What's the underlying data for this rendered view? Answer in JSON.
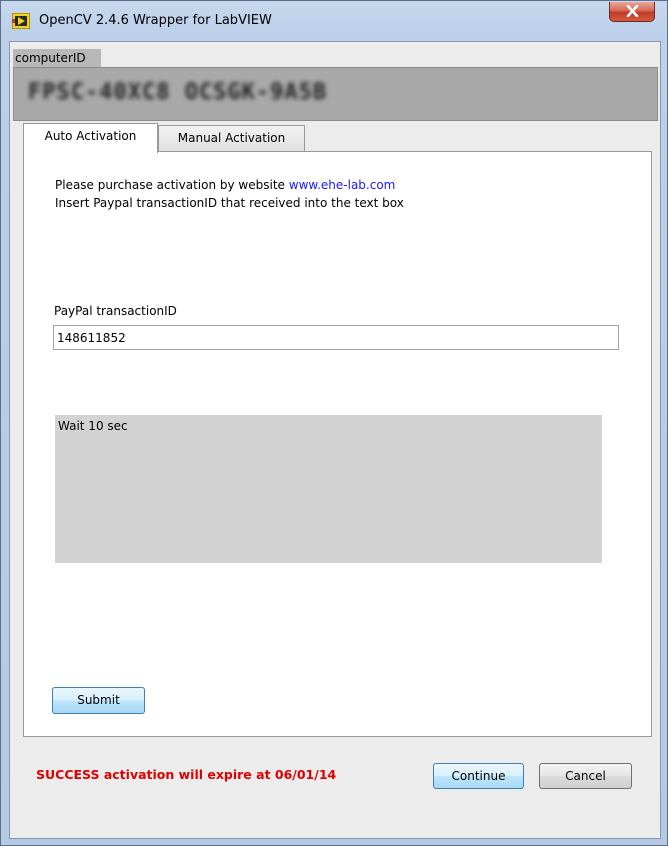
{
  "window": {
    "title": "OpenCV 2.4.6 Wrapper for LabVIEW",
    "close_icon": "close-icon"
  },
  "computer_id": {
    "label": "computerID",
    "value": "FPSC-40XC8 OCSGK-9A5B"
  },
  "tabs": [
    {
      "label": "Auto Activation",
      "active": true
    },
    {
      "label": "Manual Activation",
      "active": false
    }
  ],
  "auto_activation": {
    "info_line1_prefix": "Please purchase activation by website ",
    "info_link": "www.ehe-lab.com",
    "info_line2": "Insert Paypal  transactionID that received into the text box",
    "txid_label": "PayPal transactionID",
    "txid_value": "148611852",
    "status_text": "Wait 10 sec",
    "submit_label": "Submit"
  },
  "footer": {
    "message": "SUCCESS activation will expire at 06/01/14",
    "message_color": "#e00000",
    "continue_label": "Continue",
    "cancel_label": "Cancel"
  }
}
